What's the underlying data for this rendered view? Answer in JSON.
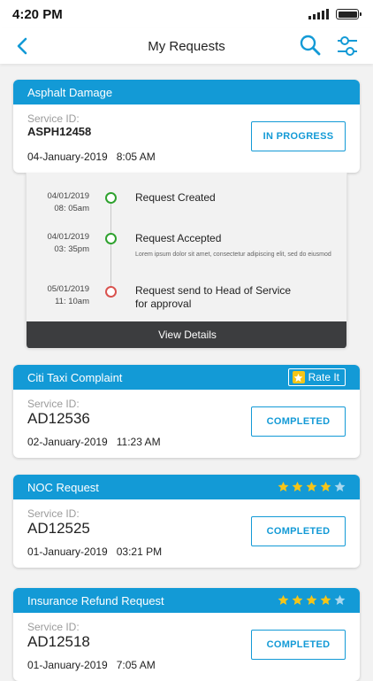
{
  "status_bar": {
    "time": "4:20 PM"
  },
  "navbar": {
    "title": "My Requests"
  },
  "requests": [
    {
      "title": "Asphalt Damage",
      "service_id_label": "Service ID:",
      "service_id": "ASPH12458",
      "date": "04-January-2019",
      "time": "8:05 AM",
      "status": "IN PROGRESS",
      "timeline": [
        {
          "date": "04/01/2019",
          "time": "08: 05am",
          "title": "Request Created",
          "status": "done"
        },
        {
          "date": "04/01/2019",
          "time": "03: 35pm",
          "title": "Request Accepted",
          "description": "Lorem ipsum dolor sit amet, consectetur adipiscing elit, sed do eiusmod",
          "status": "done"
        },
        {
          "date": "05/01/2019",
          "time": "11: 10am",
          "title": "Request send to Head of Service",
          "title_line2": "for approval",
          "status": "pending"
        }
      ],
      "view_details_label": "View Details"
    },
    {
      "title": "Citi Taxi Complaint",
      "service_id_label": "Service ID:",
      "service_id": "AD12536",
      "date": "02-January-2019",
      "time": "11:23 AM",
      "status": "COMPLETED",
      "rate_label": "Rate It"
    },
    {
      "title": "NOC Request",
      "service_id_label": "Service ID:",
      "service_id": "AD12525",
      "date": "01-January-2019",
      "time": "03:21 PM",
      "status": "COMPLETED",
      "rating": 4,
      "rating_max": 5
    },
    {
      "title": "Insurance Refund Request",
      "service_id_label": "Service ID:",
      "service_id": "AD12518",
      "date": "01-January-2019",
      "time": "7:05 AM",
      "status": "COMPLETED",
      "rating": 4,
      "rating_max": 5
    }
  ],
  "colors": {
    "accent": "#139ad6",
    "done": "#2fa22f",
    "pending": "#d9534f",
    "star_on": "#f5c518",
    "star_off": "#a9d8ee"
  }
}
